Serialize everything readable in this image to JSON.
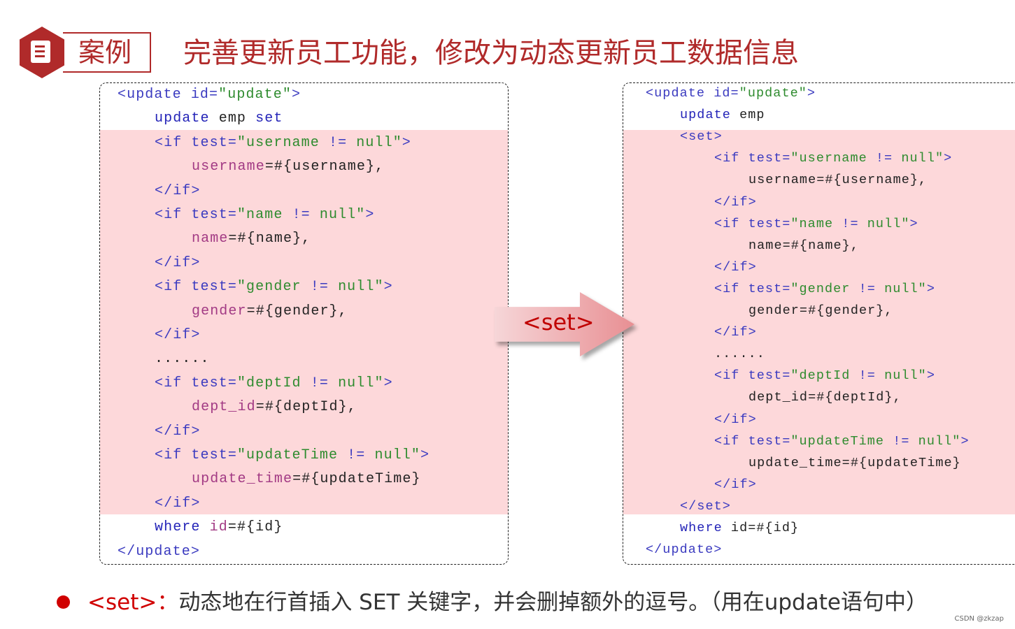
{
  "header": {
    "badge_label": "案例",
    "title": "完善更新员工功能，修改为动态更新员工数据信息",
    "badge_icon": "document-icon"
  },
  "left_code": [
    [
      0,
      [
        [
          "t",
          "<update "
        ],
        [
          "a",
          "id="
        ],
        [
          "s",
          "\"update\""
        ],
        [
          "t",
          ">"
        ]
      ]
    ],
    [
      1,
      [
        [
          "k",
          "update "
        ],
        [
          "x",
          "emp "
        ],
        [
          "k",
          "set"
        ]
      ]
    ],
    [
      1,
      [
        [
          "t",
          "<if "
        ],
        [
          "a",
          "test="
        ],
        [
          "s",
          "\"username "
        ],
        [
          "t",
          "!= "
        ],
        [
          "s",
          "null\""
        ],
        [
          "t",
          ">"
        ]
      ]
    ],
    [
      2,
      [
        [
          "p",
          "username"
        ],
        [
          "x",
          "=#{"
        ],
        [
          "x",
          "username"
        ],
        [
          "x",
          "},"
        ]
      ]
    ],
    [
      1,
      [
        [
          "t",
          "</if>"
        ]
      ]
    ],
    [
      1,
      [
        [
          "t",
          "<if "
        ],
        [
          "a",
          "test="
        ],
        [
          "s",
          "\"name "
        ],
        [
          "t",
          "!= "
        ],
        [
          "s",
          "null\""
        ],
        [
          "t",
          ">"
        ]
      ]
    ],
    [
      2,
      [
        [
          "p",
          "name"
        ],
        [
          "x",
          "=#{name},"
        ]
      ]
    ],
    [
      1,
      [
        [
          "t",
          "</if>"
        ]
      ]
    ],
    [
      1,
      [
        [
          "t",
          "<if "
        ],
        [
          "a",
          "test="
        ],
        [
          "s",
          "\"gender "
        ],
        [
          "t",
          "!= "
        ],
        [
          "s",
          "null\""
        ],
        [
          "t",
          ">"
        ]
      ]
    ],
    [
      2,
      [
        [
          "p",
          "gender"
        ],
        [
          "x",
          "=#{gender},"
        ]
      ]
    ],
    [
      1,
      [
        [
          "t",
          "</if>"
        ]
      ]
    ],
    [
      1,
      [
        [
          "x",
          "......"
        ]
      ]
    ],
    [
      1,
      [
        [
          "t",
          "<if "
        ],
        [
          "a",
          "test="
        ],
        [
          "s",
          "\"deptId "
        ],
        [
          "t",
          "!= "
        ],
        [
          "s",
          "null\""
        ],
        [
          "t",
          ">"
        ]
      ]
    ],
    [
      2,
      [
        [
          "p",
          "dept_id"
        ],
        [
          "x",
          "=#{deptId},"
        ]
      ]
    ],
    [
      1,
      [
        [
          "t",
          "</if>"
        ]
      ]
    ],
    [
      1,
      [
        [
          "t",
          "<if "
        ],
        [
          "a",
          "test="
        ],
        [
          "s",
          "\"updateTime "
        ],
        [
          "t",
          "!= "
        ],
        [
          "s",
          "null\""
        ],
        [
          "t",
          ">"
        ]
      ]
    ],
    [
      2,
      [
        [
          "p",
          "update_time"
        ],
        [
          "x",
          "=#{updateTime}"
        ]
      ]
    ],
    [
      1,
      [
        [
          "t",
          "</if>"
        ]
      ]
    ],
    [
      1,
      [
        [
          "k",
          "where "
        ],
        [
          "p",
          "id"
        ],
        [
          "x",
          "=#{id}"
        ]
      ]
    ],
    [
      0,
      [
        [
          "t",
          "</update>"
        ]
      ]
    ]
  ],
  "right_code": [
    [
      0,
      [
        [
          "t",
          "<update "
        ],
        [
          "a",
          "id="
        ],
        [
          "s",
          "\"update\""
        ],
        [
          "t",
          ">"
        ]
      ]
    ],
    [
      1,
      [
        [
          "k",
          "update "
        ],
        [
          "x",
          "emp"
        ]
      ]
    ],
    [
      1,
      [
        [
          "t",
          "<set>"
        ]
      ]
    ],
    [
      2,
      [
        [
          "t",
          "<if "
        ],
        [
          "a",
          "test="
        ],
        [
          "s",
          "\"username "
        ],
        [
          "t",
          "!= "
        ],
        [
          "s",
          "null\""
        ],
        [
          "t",
          ">"
        ]
      ]
    ],
    [
      3,
      [
        [
          "x",
          "username=#{username},"
        ]
      ]
    ],
    [
      2,
      [
        [
          "t",
          "</if>"
        ]
      ]
    ],
    [
      2,
      [
        [
          "t",
          "<if "
        ],
        [
          "a",
          "test="
        ],
        [
          "s",
          "\"name "
        ],
        [
          "t",
          "!= "
        ],
        [
          "s",
          "null\""
        ],
        [
          "t",
          ">"
        ]
      ]
    ],
    [
      3,
      [
        [
          "x",
          "name=#{name},"
        ]
      ]
    ],
    [
      2,
      [
        [
          "t",
          "</if>"
        ]
      ]
    ],
    [
      2,
      [
        [
          "t",
          "<if "
        ],
        [
          "a",
          "test="
        ],
        [
          "s",
          "\"gender "
        ],
        [
          "t",
          "!= "
        ],
        [
          "s",
          "null\""
        ],
        [
          "t",
          ">"
        ]
      ]
    ],
    [
      3,
      [
        [
          "x",
          "gender=#{gender},"
        ]
      ]
    ],
    [
      2,
      [
        [
          "t",
          "</if>"
        ]
      ]
    ],
    [
      2,
      [
        [
          "x",
          "......"
        ]
      ]
    ],
    [
      2,
      [
        [
          "t",
          "<if "
        ],
        [
          "a",
          "test="
        ],
        [
          "s",
          "\"deptId "
        ],
        [
          "t",
          "!= "
        ],
        [
          "s",
          "null\""
        ],
        [
          "t",
          ">"
        ]
      ]
    ],
    [
      3,
      [
        [
          "x",
          "dept_id=#{deptId},"
        ]
      ]
    ],
    [
      2,
      [
        [
          "t",
          "</if>"
        ]
      ]
    ],
    [
      2,
      [
        [
          "t",
          "<if "
        ],
        [
          "a",
          "test="
        ],
        [
          "s",
          "\"updateTime "
        ],
        [
          "t",
          "!= "
        ],
        [
          "s",
          "null\""
        ],
        [
          "t",
          ">"
        ]
      ]
    ],
    [
      3,
      [
        [
          "x",
          "update_time=#{updateTime}"
        ]
      ]
    ],
    [
      2,
      [
        [
          "t",
          "</if>"
        ]
      ]
    ],
    [
      1,
      [
        [
          "t",
          "</set>"
        ]
      ]
    ],
    [
      1,
      [
        [
          "k",
          "where "
        ],
        [
          "x",
          "id=#{id}"
        ]
      ]
    ],
    [
      0,
      [
        [
          "t",
          "</update>"
        ]
      ]
    ]
  ],
  "arrow": {
    "label": "<set>"
  },
  "note": {
    "keyword": "<set>：",
    "text": "动态地在行首插入 SET 关键字，并会删掉额外的逗号。（用在update语句中）"
  },
  "credit": "CSDN @zkzap",
  "colors": {
    "accent": "#b02a2a",
    "highlight": "#fdd8da",
    "tag": "#3b3bc0",
    "string": "#2e8b2e",
    "property": "#a23a84"
  }
}
